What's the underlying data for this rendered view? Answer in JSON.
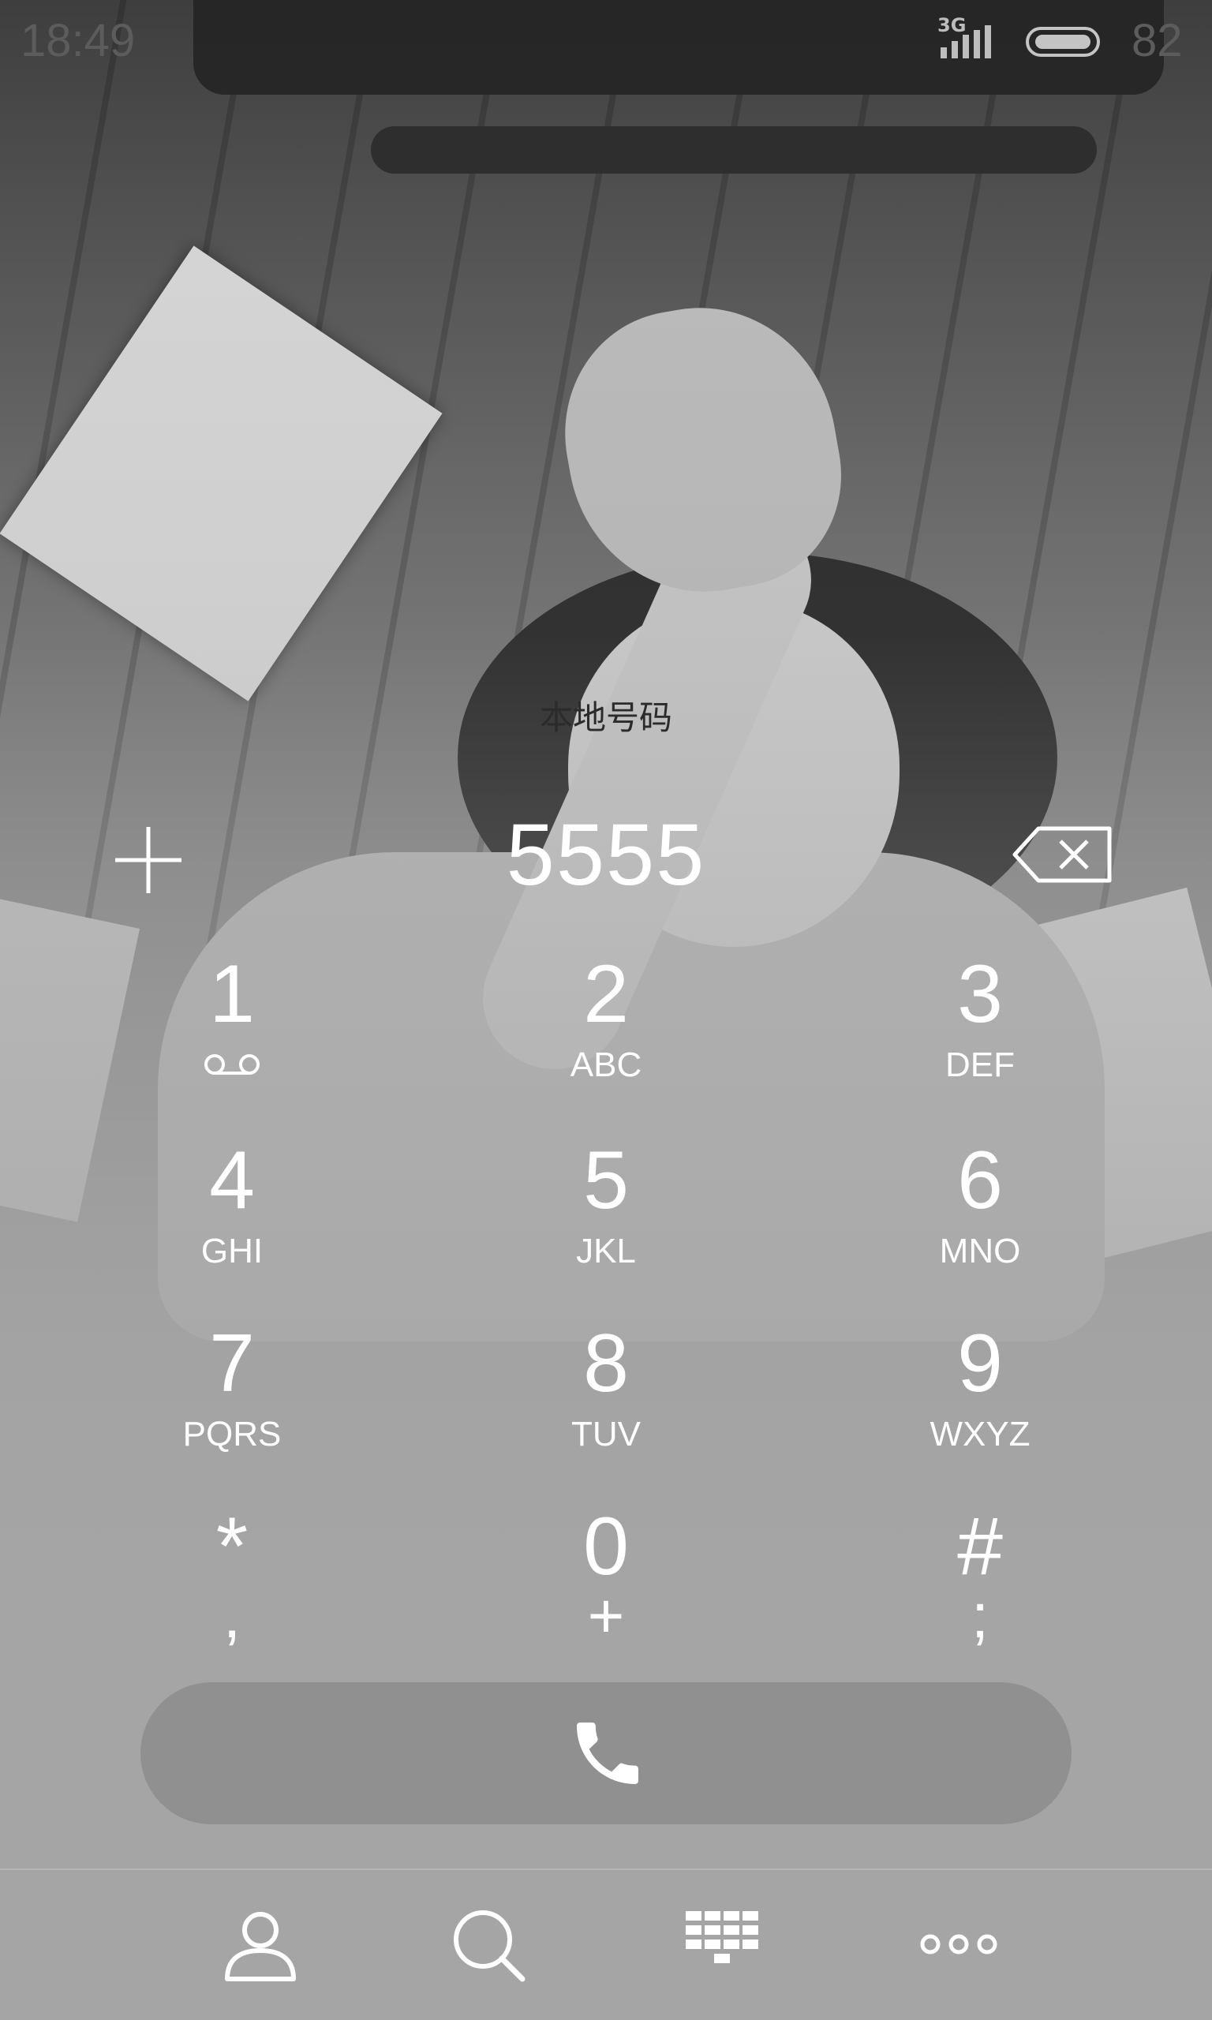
{
  "status_bar": {
    "time": "18:49",
    "network": "3G",
    "battery_text": "82"
  },
  "dialer": {
    "location": "本地号码",
    "number": "5555"
  },
  "keypad": [
    {
      "digit": "1",
      "letters": "",
      "sub": "",
      "icon": "voicemail-icon"
    },
    {
      "digit": "2",
      "letters": "ABC",
      "sub": ""
    },
    {
      "digit": "3",
      "letters": "DEF",
      "sub": ""
    },
    {
      "digit": "4",
      "letters": "GHI",
      "sub": ""
    },
    {
      "digit": "5",
      "letters": "JKL",
      "sub": ""
    },
    {
      "digit": "6",
      "letters": "MNO",
      "sub": ""
    },
    {
      "digit": "7",
      "letters": "PQRS",
      "sub": ""
    },
    {
      "digit": "8",
      "letters": "TUV",
      "sub": ""
    },
    {
      "digit": "9",
      "letters": "WXYZ",
      "sub": ""
    },
    {
      "digit": "*",
      "letters": "",
      "sub": ","
    },
    {
      "digit": "0",
      "letters": "",
      "sub": "+"
    },
    {
      "digit": "#",
      "letters": "",
      "sub": ";"
    }
  ],
  "icons": {
    "add_contact": "plus-icon",
    "backspace": "backspace-icon",
    "call": "phone-icon",
    "nav": [
      "person-icon",
      "search-icon",
      "dialpad-icon",
      "more-icon"
    ]
  },
  "colors": {
    "key_text": "#ffffff",
    "location_text": "#2b2b2b",
    "call_button_bg": "#8c8c8c"
  }
}
